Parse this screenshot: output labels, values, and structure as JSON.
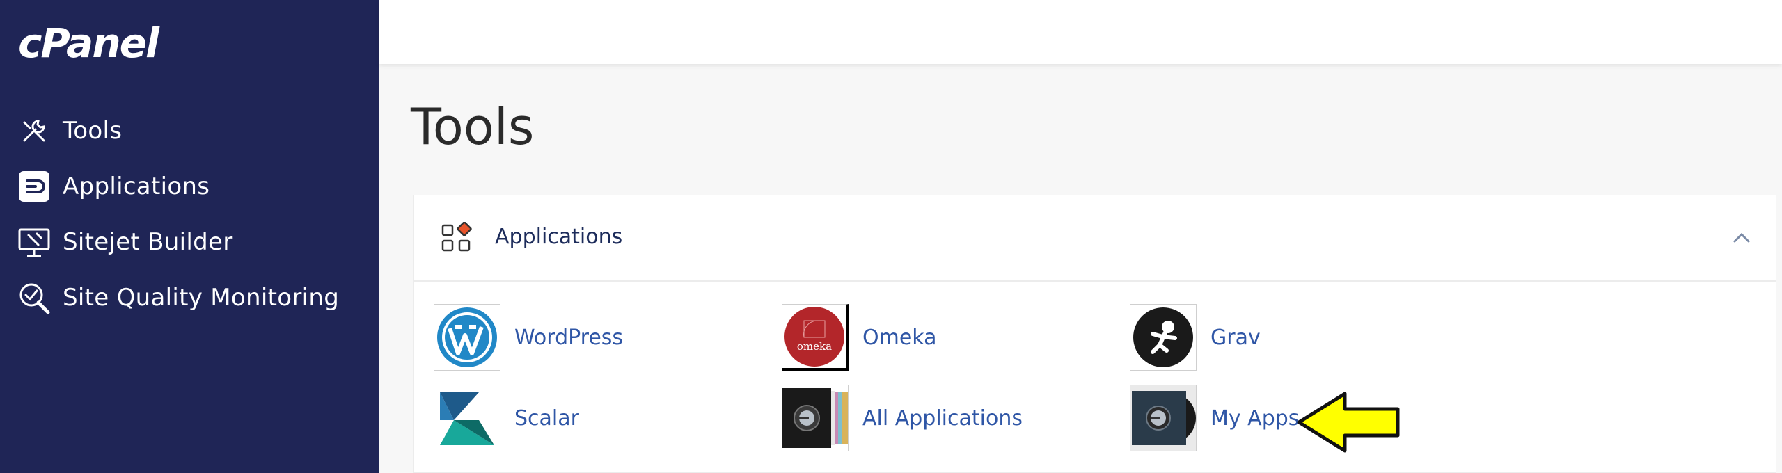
{
  "sidebar": {
    "logo": "cPanel",
    "items": [
      {
        "label": "Tools",
        "icon": "tools-icon"
      },
      {
        "label": "Applications",
        "icon": "applications-icon"
      },
      {
        "label": "Sitejet Builder",
        "icon": "sitejet-icon"
      },
      {
        "label": "Site Quality Monitoring",
        "icon": "site-quality-icon"
      }
    ]
  },
  "main": {
    "title": "Tools",
    "panel": {
      "title": "Applications",
      "apps": [
        {
          "label": "WordPress",
          "icon": "wordpress-icon"
        },
        {
          "label": "Omeka",
          "icon": "omeka-icon",
          "icon_text": "omeka"
        },
        {
          "label": "Grav",
          "icon": "grav-icon"
        },
        {
          "label": "Scalar",
          "icon": "scalar-icon"
        },
        {
          "label": "All Applications",
          "icon": "all-applications-icon"
        },
        {
          "label": "My Apps",
          "icon": "my-apps-icon"
        }
      ]
    }
  },
  "colors": {
    "sidebar_bg": "#1f2556",
    "link": "#2f56a6",
    "accent_orange": "#e8542b",
    "annotation_arrow": "#ffff00"
  },
  "annotation": {
    "type": "arrow",
    "points_to": "My Apps",
    "icon": "arrow-left-icon"
  }
}
